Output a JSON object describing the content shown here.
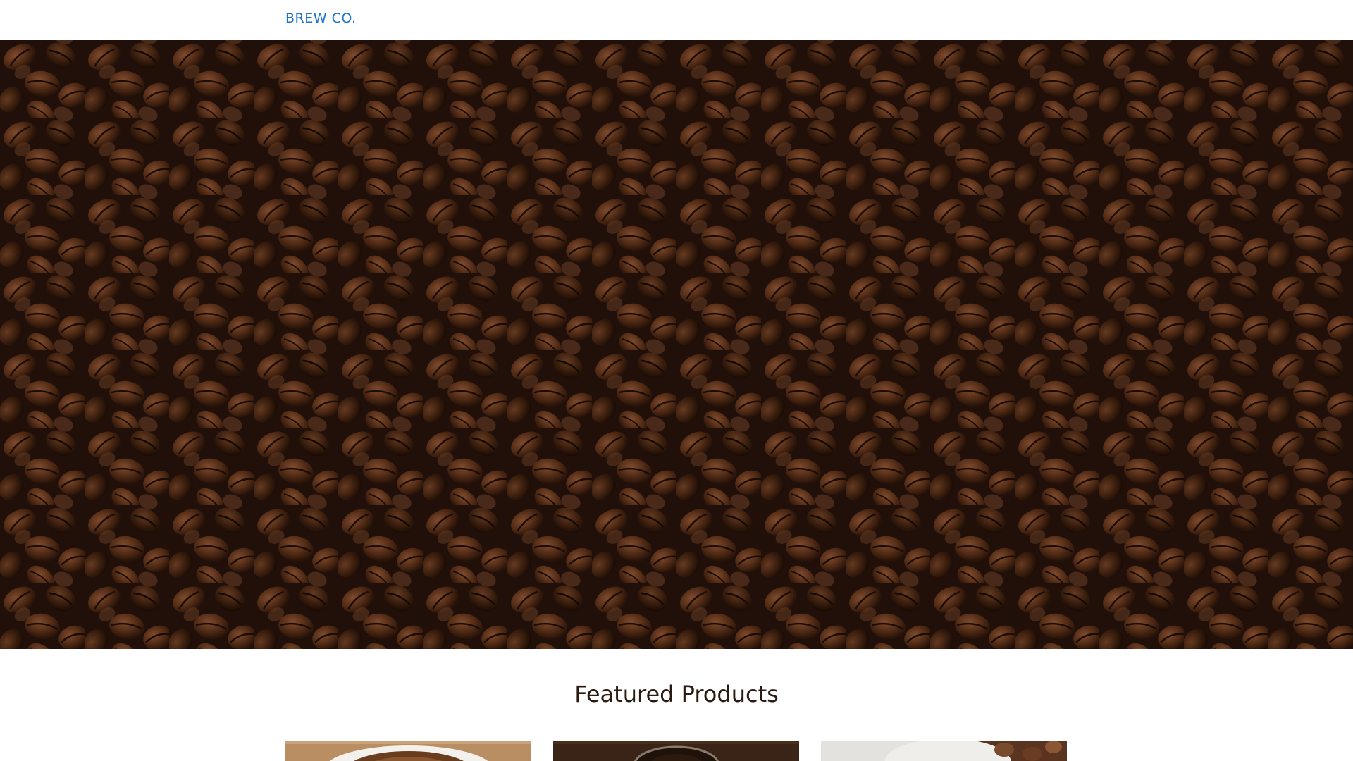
{
  "navbar": {
    "brand": "BREW CO."
  },
  "hero": {
    "image": "coffee-beans-photo"
  },
  "featured": {
    "title": "Featured Products",
    "products": [
      {
        "image": "coffee-cup-photo"
      },
      {
        "image": "ground-coffee-photo"
      },
      {
        "image": "coffee-beans-bowl-photo"
      }
    ]
  },
  "colors": {
    "brand": "#1a73c9",
    "title": "#2a1a12"
  }
}
